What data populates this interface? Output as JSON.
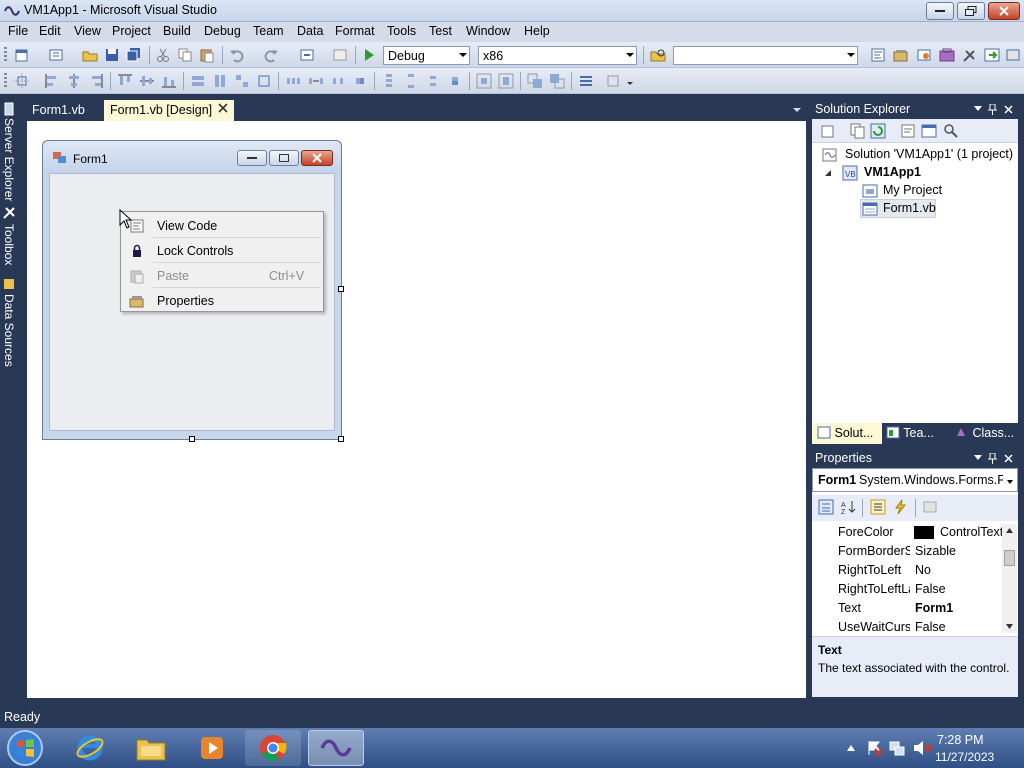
{
  "window": {
    "title": "VM1App1 - Microsoft Visual Studio"
  },
  "menu": [
    "File",
    "Edit",
    "View",
    "Project",
    "Build",
    "Debug",
    "Team",
    "Data",
    "Format",
    "Tools",
    "Test",
    "Window",
    "Help"
  ],
  "toolbar": {
    "configuration": "Debug",
    "platform": "x86",
    "find_value": ""
  },
  "left_strip": {
    "server_explorer": "Server Explorer",
    "toolbox": "Toolbox",
    "data_sources": "Data Sources"
  },
  "doc_tabs": [
    {
      "label": "Form1.vb"
    },
    {
      "label": "Form1.vb [Design]"
    }
  ],
  "form": {
    "title": "Form1"
  },
  "context_menu": {
    "items": [
      {
        "label": "View Code",
        "shortcut": ""
      },
      {
        "label": "Lock Controls",
        "shortcut": ""
      },
      {
        "label": "Paste",
        "shortcut": "Ctrl+V",
        "disabled": true
      },
      {
        "label": "Properties",
        "shortcut": ""
      }
    ]
  },
  "solution_explorer": {
    "title": "Solution Explorer",
    "tree": {
      "solution": "Solution 'VM1App1' (1 project)",
      "project": "VM1App1",
      "my_project": "My Project",
      "form_file": "Form1.vb"
    },
    "tabs": [
      "Solut...",
      "Tea...",
      "Class..."
    ]
  },
  "properties": {
    "title": "Properties",
    "object": {
      "name": "Form1",
      "type": "System.Windows.Forms.Fo"
    },
    "rows": [
      {
        "name": "ForeColor",
        "value": "ControlText",
        "swatch": "#000000"
      },
      {
        "name": "FormBorderStyle",
        "value": "Sizable"
      },
      {
        "name": "RightToLeft",
        "value": "No"
      },
      {
        "name": "RightToLeftLayout",
        "value": "False"
      },
      {
        "name": "Text",
        "value": "Form1",
        "bold": true
      },
      {
        "name": "UseWaitCursor",
        "value": "False"
      }
    ],
    "description": {
      "title": "Text",
      "text": "The text associated with the control."
    }
  },
  "status": {
    "text": "Ready"
  },
  "taskbar": {
    "time": "7:28 PM",
    "date": "11/27/2023"
  },
  "colors": {
    "chrome_dark": "#293955",
    "active_tab": "#fff8d6",
    "accent": "#2f4f85"
  }
}
